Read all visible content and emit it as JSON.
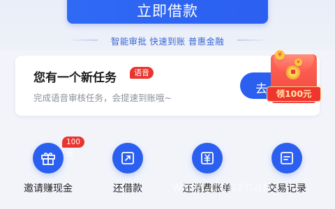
{
  "borrow_button": {
    "label": "立即借款"
  },
  "tagline": {
    "text": "智能审批 快速到账 普惠金融"
  },
  "task_card": {
    "title": "您有一个新任务",
    "badge": "语音",
    "description": "完成语音审核任务，会提速到账哦~",
    "go_button_label": "去"
  },
  "red_packet": {
    "label": "领100元",
    "coin_symbol": "¥"
  },
  "shortcuts": [
    {
      "label": "邀请赚现金",
      "icon": "gift-icon",
      "badge": "100元"
    },
    {
      "label": "还借款",
      "icon": "repay-icon"
    },
    {
      "label": "还消费账单",
      "icon": "bill-icon"
    },
    {
      "label": "交易记录",
      "icon": "record-icon"
    }
  ],
  "watermark": {
    "text": "www.douzhan"
  },
  "colors": {
    "brand_blue": "#2b5ff0",
    "badge_red": "#e8362f",
    "background": "#f2f4fa"
  }
}
